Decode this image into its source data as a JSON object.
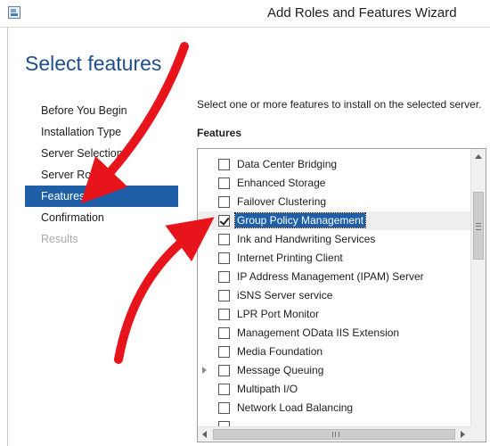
{
  "window": {
    "title": "Add Roles and Features Wizard",
    "icon": "server-manager-icon"
  },
  "page": {
    "title": "Select features"
  },
  "nav": {
    "items": [
      {
        "label": "Before You Begin",
        "state": "normal"
      },
      {
        "label": "Installation Type",
        "state": "normal"
      },
      {
        "label": "Server Selection",
        "state": "normal"
      },
      {
        "label": "Server Roles",
        "state": "normal"
      },
      {
        "label": "Features",
        "state": "active"
      },
      {
        "label": "Confirmation",
        "state": "normal"
      },
      {
        "label": "Results",
        "state": "disabled"
      }
    ]
  },
  "content": {
    "instruction": "Select one or more features to install on the selected server.",
    "features_label": "Features"
  },
  "features": [
    {
      "label": "Data Center Bridging",
      "checked": false
    },
    {
      "label": "Enhanced Storage",
      "checked": false
    },
    {
      "label": "Failover Clustering",
      "checked": false
    },
    {
      "label": "Group Policy Management",
      "checked": true,
      "selected": true
    },
    {
      "label": "Ink and Handwriting Services",
      "checked": false
    },
    {
      "label": "Internet Printing Client",
      "checked": false
    },
    {
      "label": "IP Address Management (IPAM) Server",
      "checked": false
    },
    {
      "label": "iSNS Server service",
      "checked": false
    },
    {
      "label": "LPR Port Monitor",
      "checked": false
    },
    {
      "label": "Management OData IIS Extension",
      "checked": false
    },
    {
      "label": "Media Foundation",
      "checked": false
    },
    {
      "label": "Message Queuing",
      "checked": false,
      "expandable": true
    },
    {
      "label": "Multipath I/O",
      "checked": false
    },
    {
      "label": "Network Load Balancing",
      "checked": false
    },
    {
      "label": "",
      "checked": false
    }
  ],
  "colors": {
    "accent": "#1e5fa8",
    "title": "#1f4e8c",
    "annotation_arrow": "#e8141c"
  }
}
